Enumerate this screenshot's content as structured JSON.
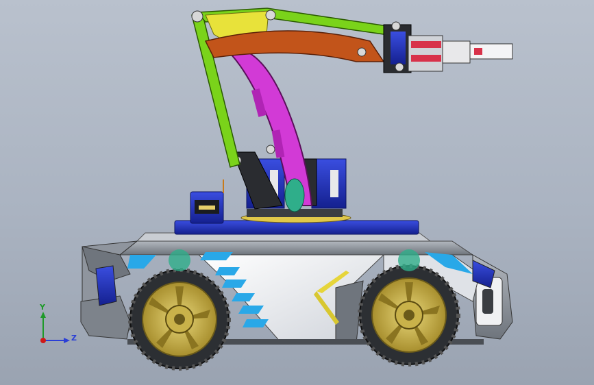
{
  "view": {
    "background_top": "#b9c1cd",
    "background_bottom": "#9aa3b1"
  },
  "triad": {
    "y_label": "Y",
    "z_label": "Z",
    "y_color": "#1f9a2a",
    "z_color": "#2b3fd6",
    "origin_color": "#d01818"
  },
  "model": {
    "parts": [
      "chassis",
      "body-panel",
      "front-wheel",
      "rear-wheel",
      "turntable",
      "base-servo",
      "shoulder-servo",
      "lower-arm",
      "upper-arm",
      "linkage",
      "gripper"
    ],
    "colors": {
      "chassis_blue": "#1d2fb8",
      "body_white": "#f2f3f6",
      "body_grey": "#8d939c",
      "accent_cyan": "#29a8e8",
      "lower_arm": "#d23ad6",
      "upper_arm_green": "#7ad31a",
      "upper_arm_yellow": "#e8e23a",
      "linkage_orange": "#c2541a",
      "rim_gold": "#c9b24a",
      "tyre": "#2c2f33",
      "gripper_red": "#d8324a"
    }
  }
}
